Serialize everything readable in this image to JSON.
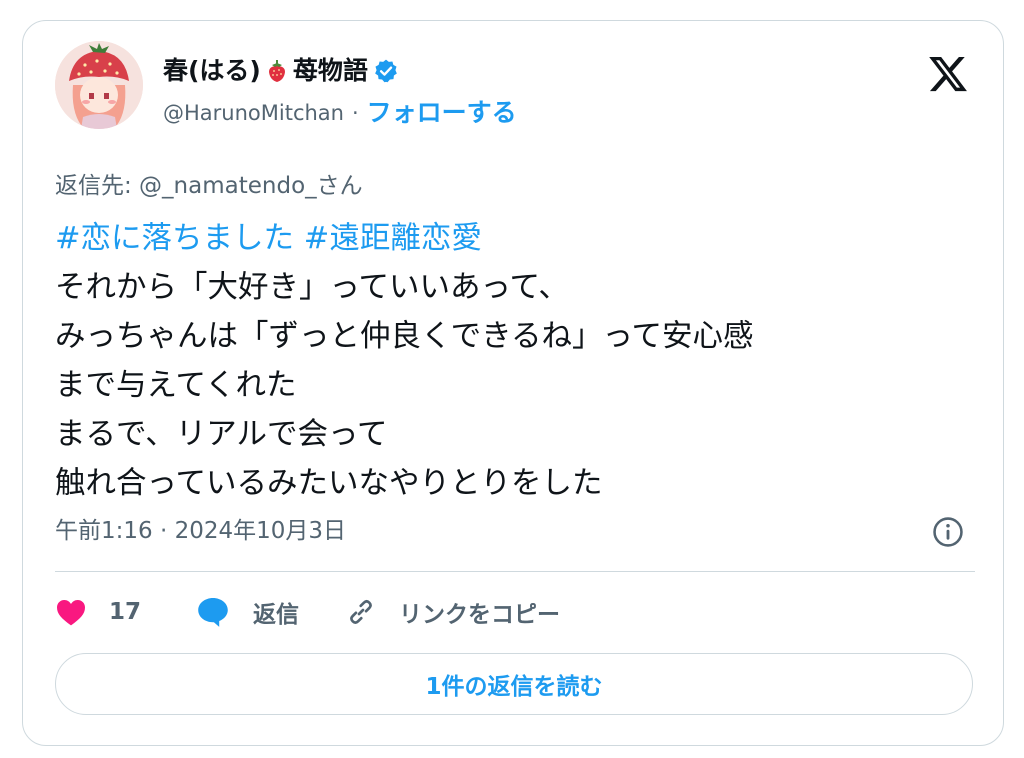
{
  "author": {
    "display_name": "春(はる)",
    "display_name_suffix": "苺物語",
    "handle": "@HarunoMitchan",
    "separator": "·",
    "follow_label": "フォローする",
    "verified": true,
    "avatar_icon": "strawberry-hat-girl-avatar",
    "emoji_icon": "strawberry-icon"
  },
  "reply_to": "返信先: @_namatendo_さん",
  "tweet": {
    "hashtags": [
      "#恋に落ちました",
      "#遠距離恋愛"
    ],
    "lines": [
      "それから「大好き」っていいあって、",
      "みっちゃんは「ずっと仲良くできるね」って安心感",
      "まで与えてくれた",
      "まるで、リアルで会って",
      "触れ合っているみたいなやりとりをした"
    ]
  },
  "timestamp": "午前1:16 · 2024年10月3日",
  "actions": {
    "like_count": "17",
    "reply_label": "返信",
    "copy_link_label": "リンクをコピー"
  },
  "read_replies_label": "1件の返信を読む",
  "colors": {
    "accent": "#1d9bf0",
    "like": "#f91880",
    "text": "#0f1419",
    "muted": "#536471",
    "border": "#cfd9de"
  },
  "icons": [
    "x-logo-icon",
    "verified-badge-icon",
    "strawberry-icon",
    "info-icon",
    "heart-icon",
    "speech-bubble-icon",
    "link-icon"
  ]
}
